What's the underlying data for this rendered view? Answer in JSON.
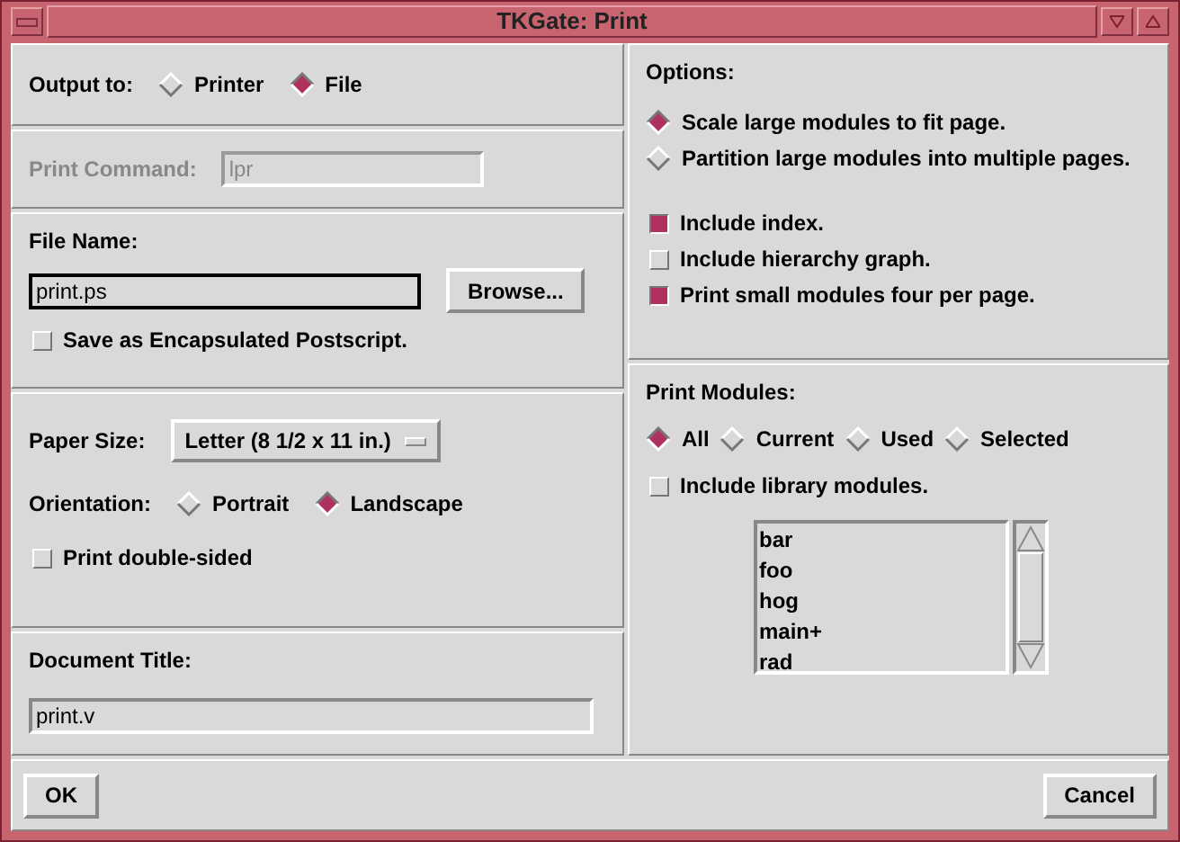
{
  "window": {
    "title": "TKGate: Print"
  },
  "output": {
    "label": "Output to:",
    "options": [
      {
        "label": "Printer",
        "selected": false
      },
      {
        "label": "File",
        "selected": true
      }
    ]
  },
  "print_command": {
    "label": "Print Command:",
    "value": "lpr",
    "disabled": true
  },
  "file_name": {
    "label": "File Name:",
    "value": "print.ps",
    "browse": "Browse...",
    "eps": {
      "label": "Save as Encapsulated Postscript.",
      "checked": false
    }
  },
  "paper_size": {
    "label": "Paper Size:",
    "value": "Letter (8 1/2 x 11 in.)"
  },
  "orientation": {
    "label": "Orientation:",
    "options": [
      {
        "label": "Portrait",
        "selected": false
      },
      {
        "label": "Landscape",
        "selected": true
      }
    ]
  },
  "double_sided": {
    "label": "Print double-sided",
    "checked": false
  },
  "document_title": {
    "label": "Document Title:",
    "value": "print.v"
  },
  "options": {
    "label": "Options:",
    "scaling": [
      {
        "label": "Scale large modules to fit page.",
        "selected": true
      },
      {
        "label": "Partition large modules into multiple pages.",
        "selected": false
      }
    ],
    "checks": [
      {
        "label": "Include index.",
        "checked": true
      },
      {
        "label": "Include hierarchy graph.",
        "checked": false
      },
      {
        "label": "Print small modules four per page.",
        "checked": true
      }
    ]
  },
  "print_modules": {
    "label": "Print Modules:",
    "options": [
      {
        "label": "All",
        "selected": true
      },
      {
        "label": "Current",
        "selected": false
      },
      {
        "label": "Used",
        "selected": false
      },
      {
        "label": "Selected",
        "selected": false
      }
    ],
    "include_library": {
      "label": "Include library modules.",
      "checked": false
    },
    "modules": [
      "bar",
      "foo",
      "hog",
      "main+",
      "rad"
    ]
  },
  "buttons": [
    "OK",
    "Cancel"
  ]
}
